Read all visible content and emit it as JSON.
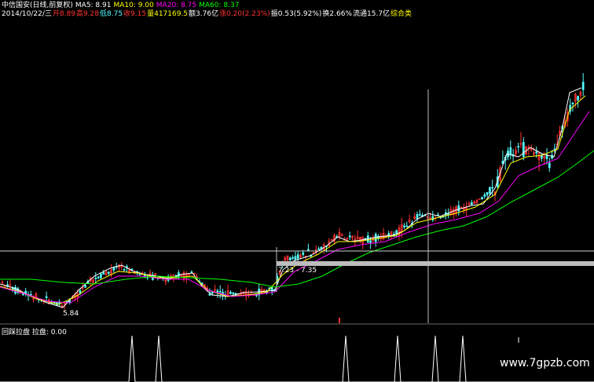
{
  "header": {
    "title": "中信国安(日线,前复权)",
    "ma5": "MA5: 8.91",
    "ma10": "MA10: 9.00",
    "ma20": "MA20: 8.75",
    "ma60": "MA60: 8.37",
    "date": "2014/10/22/三",
    "open": "开8.89",
    "high": "高9.28",
    "low": "低8.75",
    "close": "收9.15",
    "volume": "量417169.5",
    "amount": "额3.76亿",
    "change": "涨0.20(2.23%)",
    "amplitude": "振0.53(5.92%)",
    "turnover": "换2.66%",
    "float_cap": "流通15.7亿",
    "category": "综合类"
  },
  "annotations": {
    "low_price": "5.84",
    "range": "7.23 - 7.35"
  },
  "indicator": {
    "label": "回踩拉盘 拉盘: 0.00"
  },
  "watermark": "www.7gpzb.com",
  "colors": {
    "background": "#000000",
    "up_candle": "#ff3232",
    "down_candle": "#54ffff",
    "ma5": "#ffffff",
    "ma10": "#ffff00",
    "ma20": "#ff00ff",
    "ma60": "#00ff00"
  }
}
